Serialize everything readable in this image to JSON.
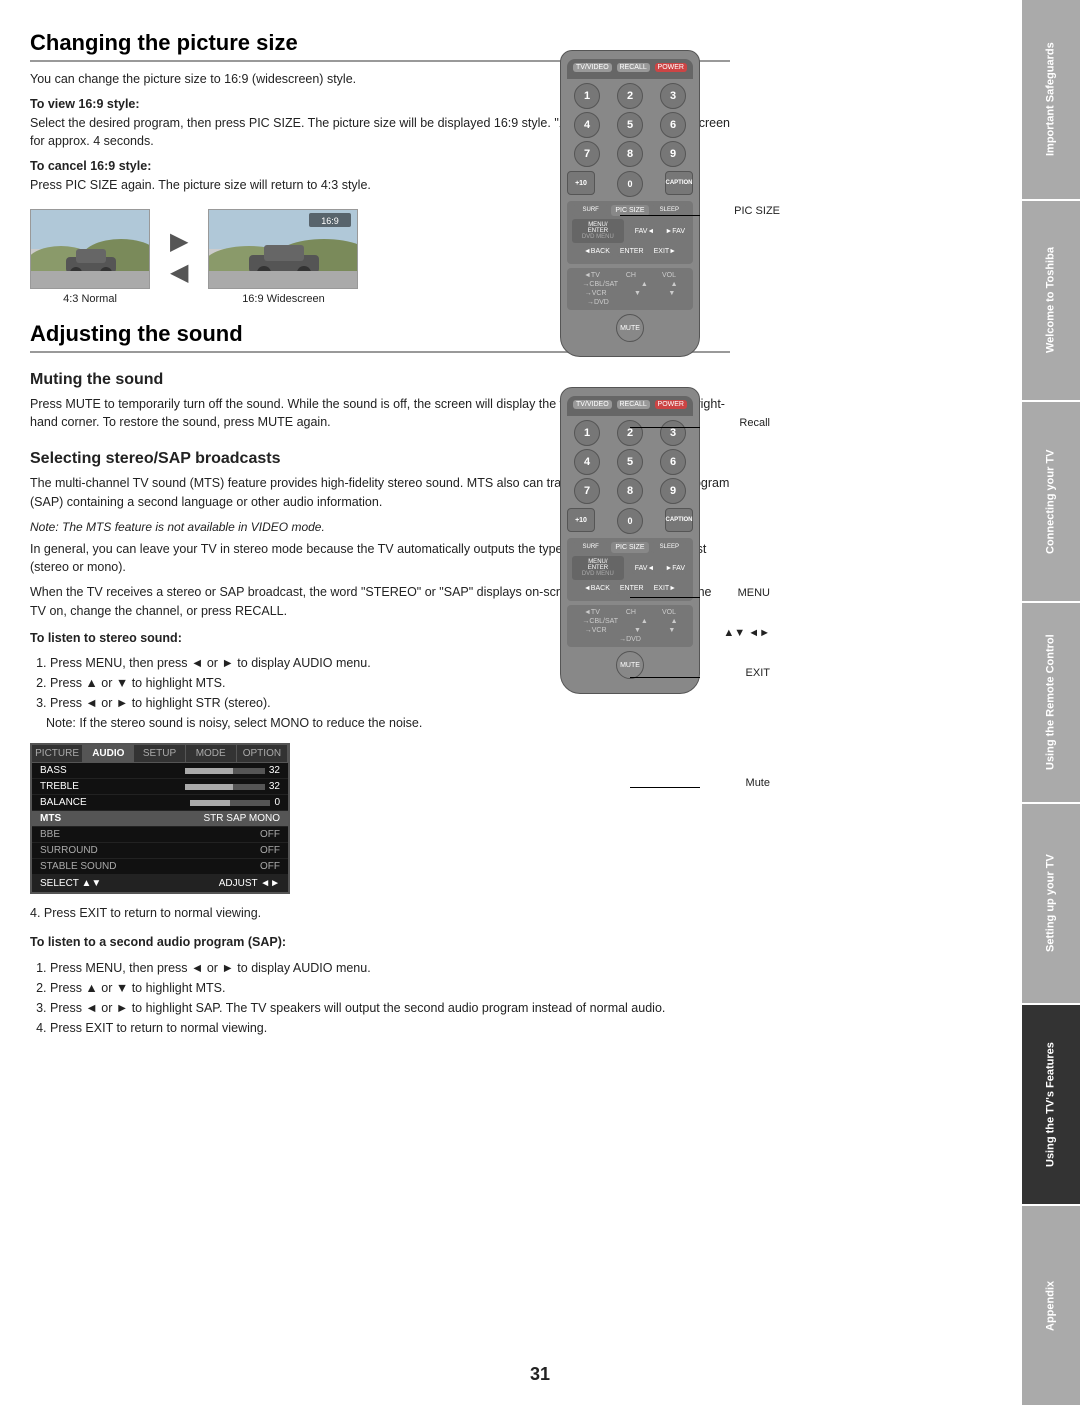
{
  "page_number": "31",
  "side_tabs": [
    {
      "label": "Important Safeguards",
      "style": "gray"
    },
    {
      "label": "Welcome to Toshiba",
      "style": "gray"
    },
    {
      "label": "Connecting your TV",
      "style": "gray"
    },
    {
      "label": "Using the Remote Control",
      "style": "gray"
    },
    {
      "label": "Setting up your TV",
      "style": "gray"
    },
    {
      "label": "Using the TV's Features",
      "style": "active"
    },
    {
      "label": "Appendix",
      "style": "gray"
    }
  ],
  "section1": {
    "title": "Changing the picture size",
    "intro": "You can change the picture size to 16:9 (widescreen) style.",
    "to_view_label": "To view 16:9 style:",
    "to_view_text": "Select the desired program, then press PIC SIZE. The picture size will be displayed 16:9 style. \"16:9\" will appear on the screen for approx. 4 seconds.",
    "to_cancel_label": "To cancel 16:9 style:",
    "to_cancel_text": "Press PIC SIZE again. The picture size will return to 4:3 style.",
    "diagram_normal_label": "4:3 Normal",
    "diagram_wide_label": "16:9 Widescreen",
    "pic_size_annotation": "PIC SIZE"
  },
  "section2": {
    "title": "Adjusting the sound",
    "muting_title": "Muting the sound",
    "muting_text": "Press MUTE to temporarily turn off the sound. While the sound is off, the screen will display the word MUTE in the lower right-hand corner. To restore the sound, press MUTE again.",
    "stereo_title": "Selecting stereo/SAP broadcasts",
    "stereo_p1": "The multi-channel TV sound (MTS) feature provides high-fidelity stereo sound. MTS also can transmit a second audio program (SAP) containing a second language or other audio information.",
    "stereo_note": "Note: The MTS feature is not available in VIDEO mode.",
    "stereo_p2": "In general, you can leave your TV in stereo mode because the TV automatically outputs the type of sound being broadcast (stereo or mono).",
    "stereo_p3": "When the TV receives a stereo or SAP broadcast, the word \"STEREO\" or \"SAP\" displays on-screen every time you turn the TV on, change the channel, or press RECALL.",
    "listen_stereo_label": "To listen to stereo sound:",
    "listen_stereo_steps": [
      "Press MENU, then press ◄ or ► to display AUDIO menu.",
      "Press ▲ or ▼ to highlight MTS.",
      "Press ◄ or ► to highlight STR (stereo).",
      "Note: If the stereo sound is noisy, select MONO to reduce the noise."
    ],
    "step4_after_menu": "4. Press EXIT to return to normal viewing.",
    "listen_sap_label": "To listen to a second audio program (SAP):",
    "listen_sap_steps": [
      "Press MENU, then press ◄ or ► to display AUDIO menu.",
      "Press ▲ or ▼ to highlight MTS.",
      "Press ◄ or ► to highlight SAP. The TV speakers will output the second audio program instead of normal audio.",
      "Press EXIT to return to normal viewing."
    ]
  },
  "menu_mockup": {
    "tabs": [
      "PICTURE",
      "AUDIO",
      "SETUP",
      "MODE",
      "OPTION"
    ],
    "rows": [
      {
        "label": "BASS",
        "value": "32",
        "has_bar": true
      },
      {
        "label": "TREBLE",
        "value": "32",
        "has_bar": true
      },
      {
        "label": "BALANCE",
        "value": "0",
        "has_bar": true
      },
      {
        "label": "MTS",
        "value": "STR SAP MONO",
        "highlighted": true
      },
      {
        "label": "BBE",
        "value": "OFF"
      },
      {
        "label": "SURROUND",
        "value": "OFF"
      },
      {
        "label": "STABLE SOUND",
        "value": "OFF"
      }
    ],
    "bottom_left": "SELECT  ▲▼",
    "bottom_right": "ADJUST  ◄►"
  },
  "remote_annotations": {
    "pic_size": "PIC SIZE",
    "recall": "Recall",
    "menu": "MENU",
    "nav": "▲▼ ◄►",
    "exit": "EXIT",
    "mute": "Mute"
  }
}
